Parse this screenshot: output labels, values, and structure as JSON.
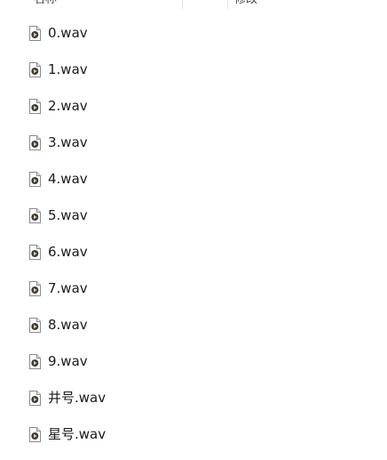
{
  "header": {
    "name_label": "名称",
    "date_label": "修改"
  },
  "files": [
    {
      "name": "0.wav",
      "icon": "audio-file-icon"
    },
    {
      "name": "1.wav",
      "icon": "audio-file-icon"
    },
    {
      "name": "2.wav",
      "icon": "audio-file-icon"
    },
    {
      "name": "3.wav",
      "icon": "audio-file-icon"
    },
    {
      "name": "4.wav",
      "icon": "audio-file-icon"
    },
    {
      "name": "5.wav",
      "icon": "audio-file-icon"
    },
    {
      "name": "6.wav",
      "icon": "audio-file-icon"
    },
    {
      "name": "7.wav",
      "icon": "audio-file-icon"
    },
    {
      "name": "8.wav",
      "icon": "audio-file-icon"
    },
    {
      "name": "9.wav",
      "icon": "audio-file-icon"
    },
    {
      "name": "井号.wav",
      "icon": "audio-file-icon"
    },
    {
      "name": "星号.wav",
      "icon": "audio-file-icon"
    }
  ],
  "colors": {
    "icon_play": "#7a2b2b",
    "icon_border": "#8a8a8a"
  }
}
